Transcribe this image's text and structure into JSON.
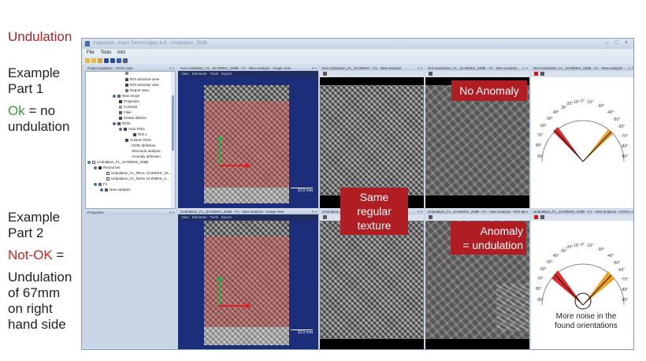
{
  "slide": {
    "title": "Undulation",
    "part1": [
      "Example",
      "Part 1"
    ],
    "part1_ok": "Ok",
    "part1_rest": "= no",
    "part1_line3": "undulation",
    "part2": [
      "Example",
      "Part 2"
    ],
    "part2_nok": "Not-OK",
    "part2_eq": " =",
    "part2_lines": [
      "Undulation",
      "of 67mm",
      "on right",
      "hand side"
    ]
  },
  "window": {
    "title": "Inspection - Hass Technologies ILS - Undulation_25dB",
    "controls": "– □ ×",
    "menu": [
      "File",
      "Tools",
      "Info"
    ]
  },
  "panels": {
    "project_explorer": "Project Explorer - HOIS view",
    "properties": "Properties",
    "close": "× ×",
    "top_image_view": "Not Undulation_FL_10.00MHz_25dB - F1 - New analysis - Image view",
    "top_view2": "Not Undulation_FL_10.00MHz - F1 - New analysis",
    "top_view3": "Not Undulation_FL_10.00MHz_25dB - F1 - New analysis - ...",
    "top_view4": "Not Undulation_FL_10.00MHz_25dB - F1 - New analysis - ...",
    "bot_image_view": "Undulation_FL_10.00MHz_25dB - F1 - New analysis - Image view",
    "bot_view2": "Undulation_FL_10.00MHz_25dB - F1 - New analysis",
    "bot_view3": "Undulation_FL_10.00MHz_25dB - F1 - New analysis - ROI an...",
    "bot_view4": "Undulation_FL_10.00MHz_25dB - F1 - New analysis - HOIS...",
    "viewer_menu": [
      "View",
      "Elements",
      "Tools",
      "Export"
    ],
    "scale": "10.0 mm"
  },
  "tree": [
    "ROI structure view",
    "ROI anomaly view",
    "Report view",
    "New recipe",
    "Projection",
    "Contrast",
    "Filter",
    "Global defects",
    "ROIs",
    "Auto ROIs",
    "ROI 1",
    "Custom ROIs",
    "HOID definition",
    "Structural analysis",
    "Anomaly definition",
    "Undulation_FL_10.00MHz_25dB",
    "Resources",
    "Undulation_FL_REAL 10.00MHz_25...",
    "Undulation_FL_IMAG 10.00MHz_2...",
    "F1",
    "New analysis"
  ],
  "callouts": {
    "no_anomaly": "No Anomaly",
    "same_texture": [
      "Same",
      "regular",
      "texture"
    ],
    "anomaly": [
      "Anomaly",
      "= undulation"
    ],
    "noise_note": [
      "More noise in the",
      "found orientations"
    ]
  },
  "gauge": {
    "left_labels": [
      "-20°",
      "10°",
      "0°",
      "-10°",
      "30°",
      "40°",
      "50°",
      "60°",
      "70°",
      "80°",
      "90°"
    ],
    "right_labels": [
      "-30°",
      "-40°",
      "-50°",
      "-60°",
      "-70°",
      "-80°",
      "-90°"
    ]
  },
  "colors": {
    "title_red": "#b22222",
    "ok_green": "#3a9a3a",
    "nok_red": "#d62020",
    "callout_red": "#b01e23",
    "viewer_blue": "#1c2d7a",
    "gauge_red": "#e02a2a",
    "gauge_orange": "#f0a020"
  }
}
